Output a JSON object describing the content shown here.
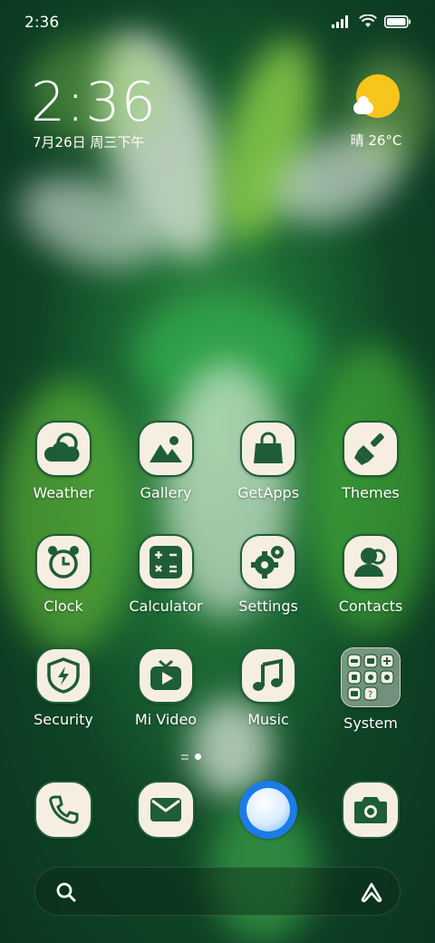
{
  "status_bar": {
    "time": "2:36"
  },
  "clock_widget": {
    "time": "2:36",
    "date": "7月26日 周三下午"
  },
  "weather_widget": {
    "text": "晴 26°C",
    "icon": "sun-cloud-icon"
  },
  "apps": [
    {
      "label": "Weather",
      "icon": "weather-icon"
    },
    {
      "label": "Gallery",
      "icon": "gallery-icon"
    },
    {
      "label": "GetApps",
      "icon": "shopping-bag-icon"
    },
    {
      "label": "Themes",
      "icon": "paintbrush-icon"
    },
    {
      "label": "Clock",
      "icon": "alarm-clock-icon"
    },
    {
      "label": "Calculator",
      "icon": "calculator-icon"
    },
    {
      "label": "Settings",
      "icon": "gear-icon"
    },
    {
      "label": "Contacts",
      "icon": "contacts-icon"
    },
    {
      "label": "Security",
      "icon": "shield-icon"
    },
    {
      "label": "Mi Video",
      "icon": "tv-play-icon"
    },
    {
      "label": "Music",
      "icon": "music-note-icon"
    },
    {
      "label": "System",
      "icon": "folder-icon"
    }
  ],
  "dock": [
    {
      "name": "phone",
      "icon": "phone-icon"
    },
    {
      "name": "messages",
      "icon": "envelope-icon"
    },
    {
      "name": "browser",
      "icon": "browser-icon"
    },
    {
      "name": "camera",
      "icon": "camera-icon"
    }
  ],
  "search_bar": {
    "search_icon": "search-icon",
    "assistant_icon": "assistant-icon"
  },
  "colors": {
    "icon_bg": "#f6efe1",
    "icon_fg": "#1f5c38",
    "sun": "#f7c51c",
    "browser": "#1d7be8"
  }
}
